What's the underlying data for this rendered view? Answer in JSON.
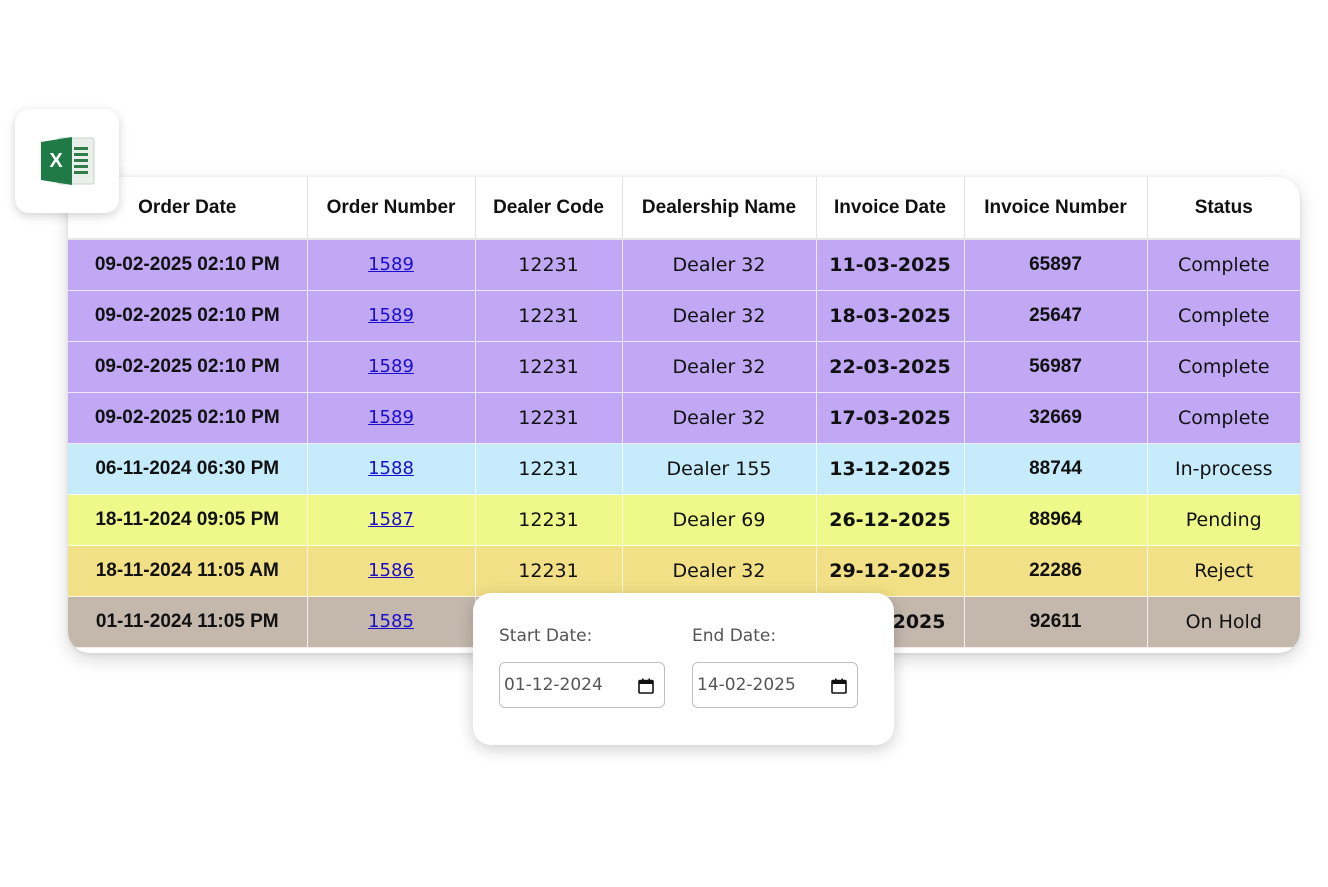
{
  "table": {
    "columns": [
      "Order Date",
      "Order Number",
      "Dealer Code",
      "Dealership Name",
      "Invoice Date",
      "Invoice Number",
      "Status"
    ],
    "rows": [
      {
        "order_date": "09-02-2025 02:10 PM",
        "order_number": "1589",
        "dealer_code": "12231",
        "dealership_name": "Dealer 32",
        "invoice_date": "11-03-2025",
        "invoice_number": "65897",
        "status": "Complete",
        "color": "#c0a8f4"
      },
      {
        "order_date": "09-02-2025 02:10 PM",
        "order_number": "1589",
        "dealer_code": "12231",
        "dealership_name": "Dealer 32",
        "invoice_date": "18-03-2025",
        "invoice_number": "25647",
        "status": "Complete",
        "color": "#c0a8f4"
      },
      {
        "order_date": "09-02-2025 02:10 PM",
        "order_number": "1589",
        "dealer_code": "12231",
        "dealership_name": "Dealer 32",
        "invoice_date": "22-03-2025",
        "invoice_number": "56987",
        "status": "Complete",
        "color": "#c0a8f4"
      },
      {
        "order_date": "09-02-2025 02:10 PM",
        "order_number": "1589",
        "dealer_code": "12231",
        "dealership_name": "Dealer 32",
        "invoice_date": "17-03-2025",
        "invoice_number": "32669",
        "status": "Complete",
        "color": "#c0a8f4"
      },
      {
        "order_date": "06-11-2024 06:30 PM",
        "order_number": "1588",
        "dealer_code": "12231",
        "dealership_name": "Dealer 155",
        "invoice_date": "13-12-2025",
        "invoice_number": "88744",
        "status": "In-process",
        "color": "#c6ecfb"
      },
      {
        "order_date": "18-11-2024 09:05 PM",
        "order_number": "1587",
        "dealer_code": "12231",
        "dealership_name": "Dealer 69",
        "invoice_date": "26-12-2025",
        "invoice_number": "88964",
        "status": "Pending",
        "color": "#eef98a"
      },
      {
        "order_date": "18-11-2024 11:05 AM",
        "order_number": "1586",
        "dealer_code": "12231",
        "dealership_name": "Dealer 32",
        "invoice_date": "29-12-2025",
        "invoice_number": "22286",
        "status": "Reject",
        "color": "#f2e086"
      },
      {
        "order_date": "01-11-2024 11:05 PM",
        "order_number": "1585",
        "dealer_code": "",
        "dealership_name": "",
        "invoice_date": "2025",
        "invoice_number": "92611",
        "status": "On Hold",
        "color": "#c4b8ad"
      }
    ]
  },
  "date_filter": {
    "start_label": "Start Date:",
    "start_value": "01-12-2024",
    "end_label": "End Date:",
    "end_value": "14-02-2025"
  },
  "icons": {
    "excel": "excel-icon",
    "calendar": "calendar-icon"
  },
  "colors": {
    "excel_green": "#1f7a45",
    "link": "#1a0dcc"
  }
}
